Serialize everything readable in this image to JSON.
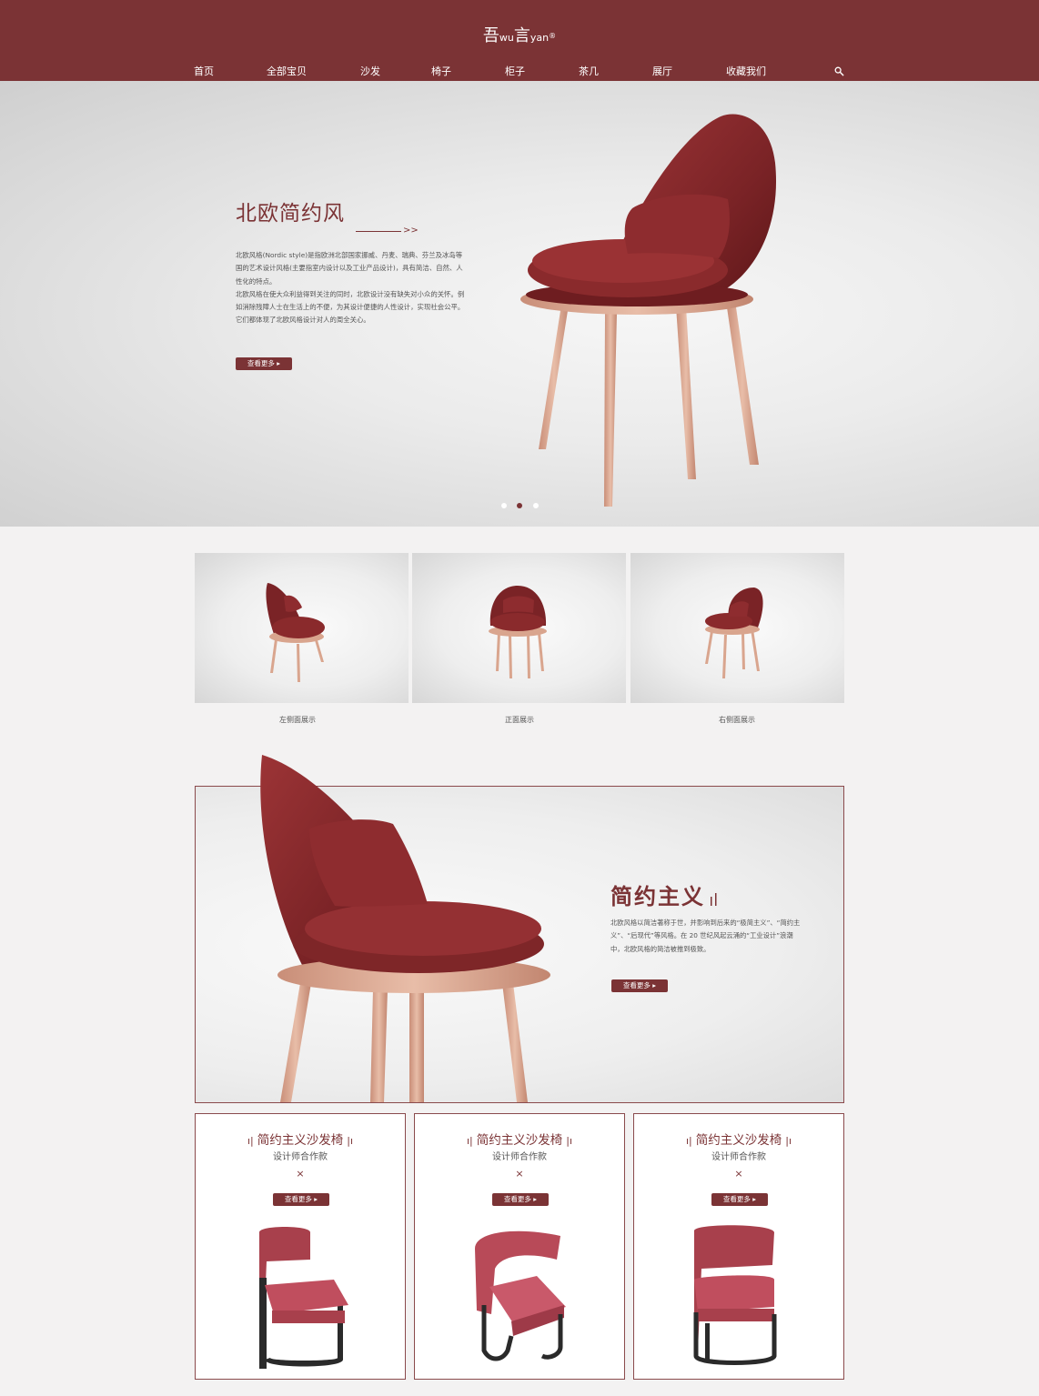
{
  "header": {
    "logo": {
      "part1": "吾",
      "part2": "wu",
      "part3": "言",
      "part4": "yan",
      "mark": "®"
    },
    "nav": [
      "首页",
      "全部宝贝",
      "沙发",
      "椅子",
      "柜子",
      "茶几",
      "展厅",
      "收藏我们"
    ],
    "search_icon": "search-icon"
  },
  "hero": {
    "title": "北欧简约风",
    "arrow": ">>",
    "paragraphs": [
      "北欧风格(Nordic style)是指欧洲北部国家挪威、丹麦、瑞典、芬兰及冰岛等国的艺术设计风格(主要指室内设计以及工业产品设计)，具有简洁、自然、人性化的特点。",
      "北欧风格在使大众利益得到关注的同时，北欧设计没有缺失对小众的关怀。例如消除残障人士在生活上的不便，为其设计便捷的人性设计，实现社会公平。它们都体现了北欧风格设计对人的周全关心。"
    ],
    "button": "查看更多 ▸",
    "carousel": {
      "count": 3,
      "active": 1
    }
  },
  "gallery": [
    {
      "caption": "左侧面展示"
    },
    {
      "caption": "正面展示"
    },
    {
      "caption": "右侧面展示"
    }
  ],
  "feature": {
    "title": "简约主义",
    "desc": "北欧风格以简洁著称于世，并影响到后来的“极简主义”、“简约主义”、“后现代”等风格。在 20 世纪风起云涌的“工业设计”浪潮中，北欧风格的简洁被推到极致。",
    "button": "查看更多 ▸"
  },
  "products": [
    {
      "title": "简约主义沙发椅",
      "subtitle": "设计师合作款",
      "mark": "×",
      "button": "查看更多 ▸"
    },
    {
      "title": "简约主义沙发椅",
      "subtitle": "设计师合作款",
      "mark": "×",
      "button": "查看更多 ▸"
    },
    {
      "title": "简约主义沙发椅",
      "subtitle": "设计师合作款",
      "mark": "×",
      "button": "查看更多 ▸"
    }
  ],
  "colors": {
    "brand": "#7b3335",
    "chair_red": "#8a2a2c",
    "leg_copper": "#d9a58e",
    "product_red": "#b84a58"
  }
}
